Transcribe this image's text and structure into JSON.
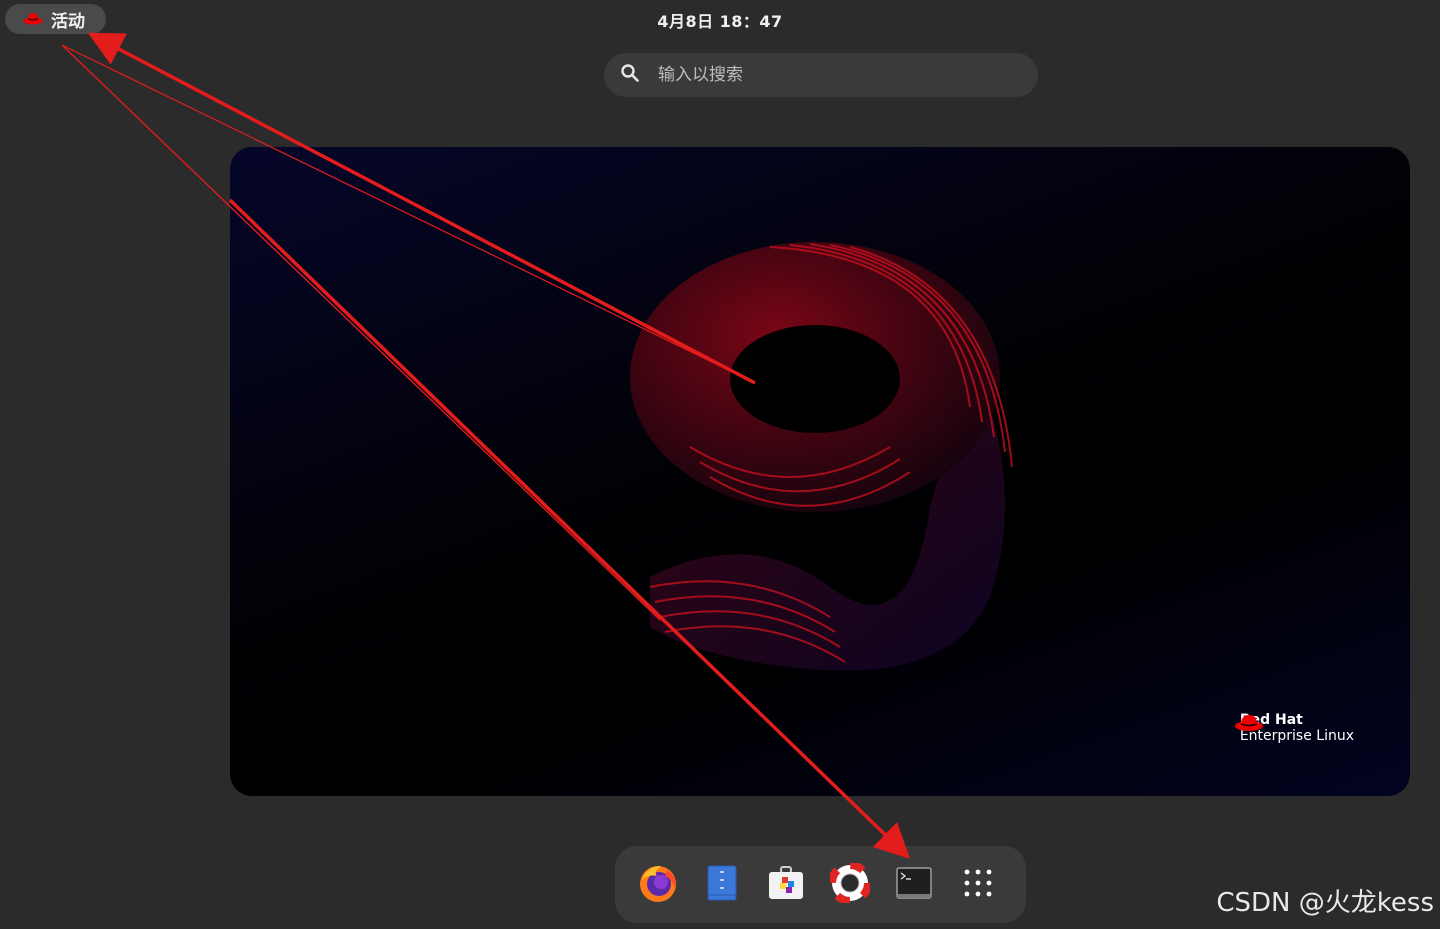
{
  "topbar": {
    "activities_label": "活动",
    "clock": "4月8日  18：47"
  },
  "search": {
    "placeholder": "输入以搜索"
  },
  "workspace": {
    "brand_line1": "Red Hat",
    "brand_line2": "Enterprise Linux"
  },
  "dash": {
    "items": [
      {
        "icon": "firefox-icon"
      },
      {
        "icon": "files-icon"
      },
      {
        "icon": "software-icon"
      },
      {
        "icon": "help-icon"
      },
      {
        "icon": "terminal-icon"
      },
      {
        "icon": "app-grid-icon"
      }
    ]
  },
  "watermark": "CSDN @火龙kess",
  "colors": {
    "annotation_red": "#e31c1c",
    "redhat_red": "#ee0000"
  }
}
